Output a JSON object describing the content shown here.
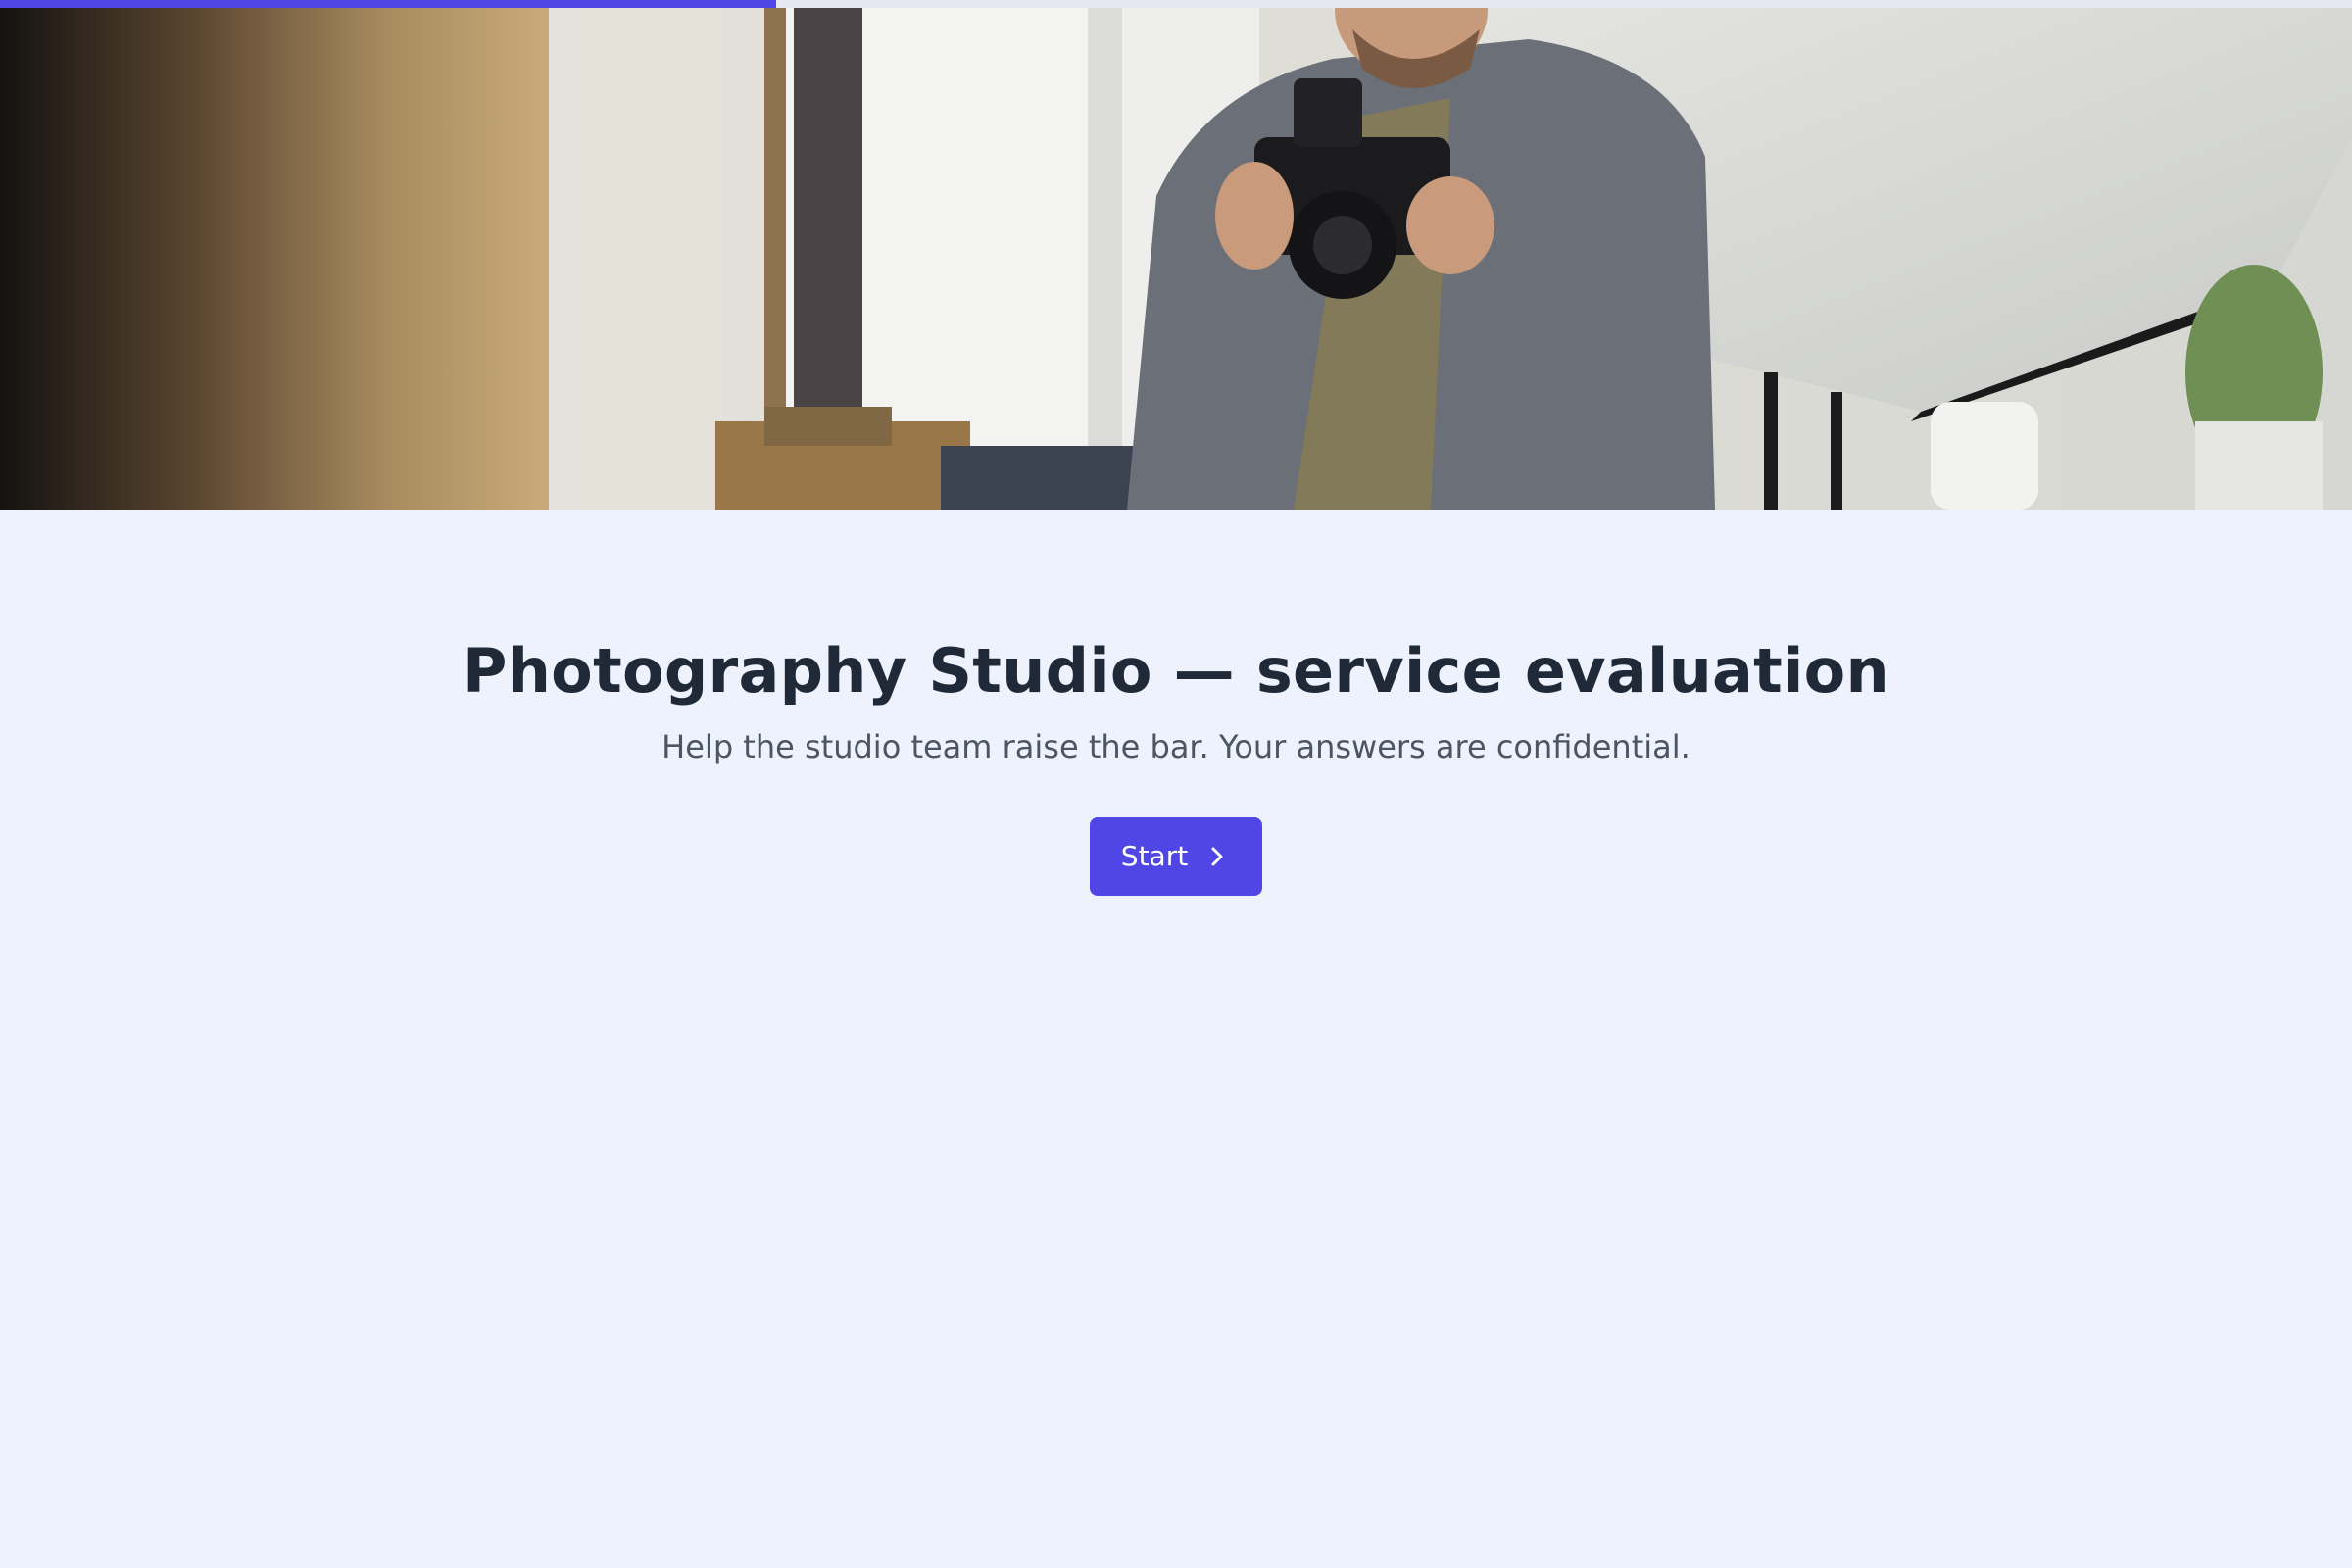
{
  "survey": {
    "title": "Photography Studio — service evaluation",
    "subtitle": "Help the studio team raise the bar. Your answers are confidential.",
    "start_label": "Start",
    "start_icon": "chevron-right-icon",
    "progress_fraction": 0.33
  },
  "hero": {
    "image_subject": "photographer-with-camera-in-studio"
  },
  "colors": {
    "accent": "#4f46e5",
    "background": "#eef2fd",
    "title": "#1f2937",
    "subtitle": "#4b5563"
  }
}
